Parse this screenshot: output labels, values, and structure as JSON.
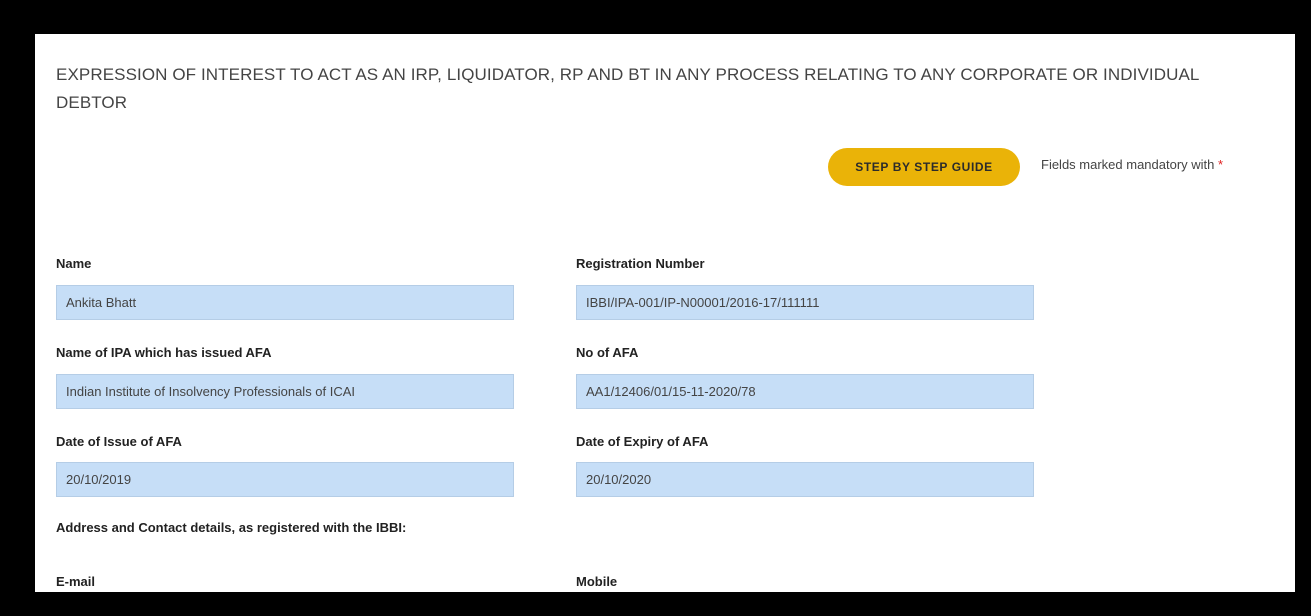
{
  "page": {
    "title": "EXPRESSION OF INTEREST TO ACT AS AN IRP, LIQUIDATOR, RP AND BT IN ANY PROCESS RELATING TO ANY CORPORATE OR INDIVIDUAL DEBTOR",
    "guide_button_label": "STEP BY STEP GUIDE",
    "mandatory_note": "Fields marked mandatory with",
    "mandatory_marker": "*"
  },
  "form": {
    "name": {
      "label": "Name",
      "value": "Ankita Bhatt"
    },
    "registration_number": {
      "label": "Registration Number",
      "value": "IBBI/IPA-001/IP-N00001/2016-17/111111"
    },
    "ipa_name": {
      "label": "Name of IPA which has issued AFA",
      "value": "Indian Institute of Insolvency Professionals of ICAI"
    },
    "afa_number": {
      "label": "No of AFA",
      "value": "AA1/12406/01/15-11-2020/78"
    },
    "afa_issue_date": {
      "label": "Date of Issue of AFA",
      "value": "20/10/2019"
    },
    "afa_expiry_date": {
      "label": "Date of Expiry of AFA",
      "value": "20/10/2020"
    },
    "contact_section_heading": "Address and Contact details, as registered with the IBBI:",
    "email": {
      "label": "E-mail"
    },
    "mobile": {
      "label": "Mobile"
    }
  },
  "colors": {
    "accent": "#eab308",
    "input_background": "#c6def7",
    "required_marker": "#e02020"
  }
}
